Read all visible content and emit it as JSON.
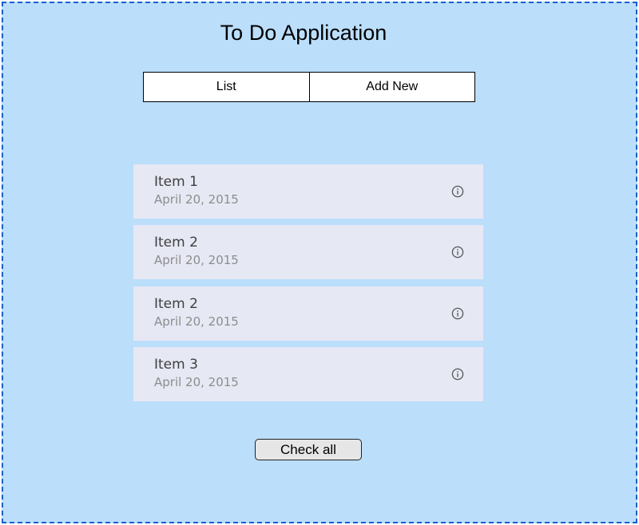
{
  "app": {
    "title": "To Do Application"
  },
  "tabs": [
    {
      "label": "List"
    },
    {
      "label": "Add New"
    }
  ],
  "items": [
    {
      "title": "Item 1",
      "date": "April 20, 2015",
      "icon": "info-icon"
    },
    {
      "title": "Item 2",
      "date": "April 20, 2015",
      "icon": "info-icon"
    },
    {
      "title": "Item 2",
      "date": "April 20, 2015",
      "icon": "info-icon"
    },
    {
      "title": "Item 3",
      "date": "April 20, 2015",
      "icon": "info-icon"
    }
  ],
  "actions": {
    "check_all_label": "Check all"
  },
  "colors": {
    "background": "#bbdefb",
    "border": "#1a5fd0",
    "item_background": "#e6e8f4",
    "button_background": "#e6e6e6"
  }
}
